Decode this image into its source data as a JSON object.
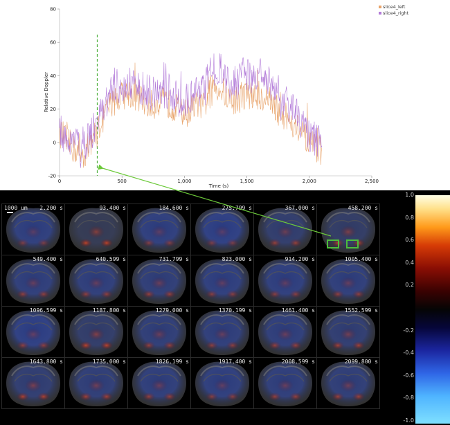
{
  "chart_data": {
    "type": "line",
    "xlabel": "Time (s)",
    "ylabel": "Relative Doppler",
    "xlim": [
      0,
      2500
    ],
    "ylim": [
      -20,
      80
    ],
    "xticks": [
      0,
      500,
      1000,
      1500,
      2000,
      2500
    ],
    "xtick_labels": [
      "0",
      "500",
      "1,000",
      "1,500",
      "2,000",
      "2,500"
    ],
    "yticks": [
      -20,
      0,
      20,
      40,
      60,
      80
    ],
    "ytick_labels": [
      "-20",
      "0",
      "20",
      "40",
      "60",
      "80"
    ],
    "grid": false,
    "legend_position": "top-right",
    "marker_time": 302,
    "series": [
      {
        "name": "slice4_left",
        "color": "#e8a36a",
        "x": [
          0,
          50,
          100,
          150,
          200,
          250,
          300,
          350,
          400,
          450,
          500,
          550,
          600,
          650,
          700,
          750,
          800,
          850,
          900,
          950,
          1000,
          1050,
          1100,
          1150,
          1200,
          1250,
          1300,
          1350,
          1400,
          1450,
          1500,
          1550,
          1600,
          1650,
          1700,
          1750,
          1800,
          1850,
          1900,
          1950,
          2000,
          2050,
          2100
        ],
        "y": [
          6,
          2,
          -3,
          -6,
          -7,
          1,
          6,
          15,
          22,
          26,
          28,
          30,
          28,
          26,
          24,
          22,
          25,
          24,
          22,
          20,
          17,
          20,
          23,
          21,
          29,
          34,
          31,
          27,
          25,
          27,
          30,
          27,
          28,
          27,
          24,
          19,
          16,
          13,
          9,
          4,
          -1,
          -3,
          -5
        ]
      },
      {
        "name": "slice4_right",
        "color": "#b27ad8",
        "x": [
          0,
          50,
          100,
          150,
          200,
          250,
          300,
          350,
          400,
          450,
          500,
          550,
          600,
          650,
          700,
          750,
          800,
          850,
          900,
          950,
          1000,
          1050,
          1100,
          1150,
          1200,
          1250,
          1300,
          1350,
          1400,
          1450,
          1500,
          1550,
          1600,
          1650,
          1700,
          1750,
          1800,
          1850,
          1900,
          1950,
          2000,
          2050,
          2100
        ],
        "y": [
          8,
          4,
          1,
          -3,
          -1,
          5,
          10,
          21,
          29,
          33,
          35,
          38,
          36,
          33,
          31,
          29,
          32,
          30,
          28,
          26,
          24,
          28,
          31,
          30,
          39,
          45,
          42,
          38,
          36,
          38,
          42,
          39,
          40,
          38,
          35,
          30,
          26,
          21,
          16,
          11,
          5,
          1,
          -2
        ]
      }
    ]
  },
  "montage": {
    "scale_label": "1000 um",
    "roi_box_color": "#4cbe3c",
    "arrow_color": "#6cc93a",
    "tiles": [
      {
        "time": "2.200 s",
        "red": 0.05,
        "blue": 0.55
      },
      {
        "time": "93.400 s",
        "red": 0.55,
        "blue": 0.05
      },
      {
        "time": "184.600 s",
        "red": 0.1,
        "blue": 0.55
      },
      {
        "time": "275.799 s",
        "red": 0.05,
        "blue": 0.6
      },
      {
        "time": "367.000 s",
        "red": 0.25,
        "blue": 0.35
      },
      {
        "time": "458.200 s",
        "red": 0.45,
        "blue": 0.25
      },
      {
        "time": "549.400 s",
        "red": 0.2,
        "blue": 0.5
      },
      {
        "time": "640.599 s",
        "red": 0.2,
        "blue": 0.5
      },
      {
        "time": "731.799 s",
        "red": 0.25,
        "blue": 0.45
      },
      {
        "time": "823.000 s",
        "red": 0.15,
        "blue": 0.55
      },
      {
        "time": "914.200 s",
        "red": 0.15,
        "blue": 0.55
      },
      {
        "time": "1005.400 s",
        "red": 0.2,
        "blue": 0.5
      },
      {
        "time": "1096.599 s",
        "red": 0.2,
        "blue": 0.6
      },
      {
        "time": "1187.800 s",
        "red": 0.55,
        "blue": 0.3
      },
      {
        "time": "1279.000 s",
        "red": 0.25,
        "blue": 0.45
      },
      {
        "time": "1370.199 s",
        "red": 0.2,
        "blue": 0.5
      },
      {
        "time": "1461.400 s",
        "red": 0.25,
        "blue": 0.5
      },
      {
        "time": "1552.599 s",
        "red": 0.35,
        "blue": 0.4
      },
      {
        "time": "1643.800 s",
        "red": 0.45,
        "blue": 0.4
      },
      {
        "time": "1735.000 s",
        "red": 0.35,
        "blue": 0.45
      },
      {
        "time": "1826.199 s",
        "red": 0.25,
        "blue": 0.5
      },
      {
        "time": "1917.400 s",
        "red": 0.15,
        "blue": 0.55
      },
      {
        "time": "2008.599 s",
        "red": 0.25,
        "blue": 0.5
      },
      {
        "time": "2099.800 s",
        "red": 0.3,
        "blue": 0.45
      }
    ]
  },
  "colorbar": {
    "ticks": [
      "1.0",
      "0.8",
      "0.6",
      "0.4",
      "0.2",
      "-0.2",
      "-0.4",
      "-0.6",
      "-0.8",
      "-1.0"
    ],
    "tick_values": [
      1.0,
      0.8,
      0.6,
      0.4,
      0.2,
      -0.2,
      -0.4,
      -0.6,
      -0.8,
      -1.0
    ]
  }
}
